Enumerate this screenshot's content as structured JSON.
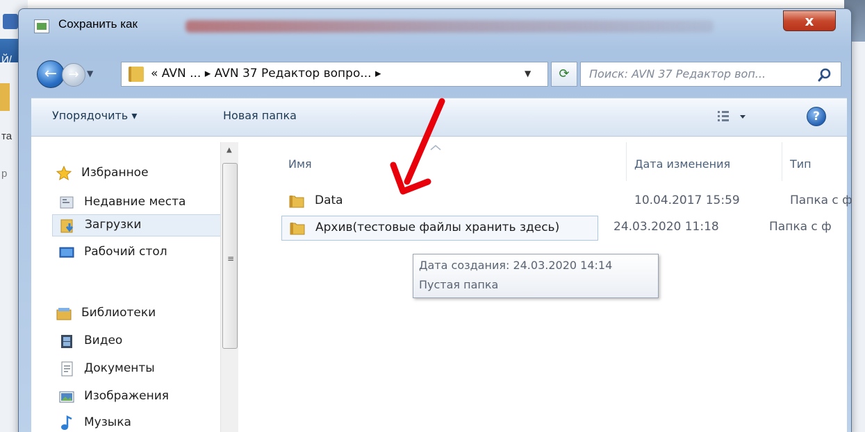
{
  "background_app": {
    "fragment_letters": [
      "Й/",
      "та",
      "р"
    ]
  },
  "window": {
    "title": "Сохранить как",
    "close_glyph": "x"
  },
  "address": {
    "path": "« AVN ... ▸ AVN 37 Редактор вопро... ▸",
    "search_placeholder": "Поиск: AVN 37 Редактор воп..."
  },
  "toolbar": {
    "organize_label": "Упорядочить ▾",
    "new_folder_label": "Новая папка",
    "help_glyph": "?"
  },
  "nav": {
    "favorites": {
      "label": "Избранное",
      "items": [
        {
          "label": "Недавние места",
          "icon": "recent-places-icon"
        },
        {
          "label": "Загрузки",
          "icon": "downloads-icon",
          "selected": true
        },
        {
          "label": "Рабочий стол",
          "icon": "desktop-icon"
        }
      ]
    },
    "libraries": {
      "label": "Библиотеки",
      "items": [
        {
          "label": "Видео",
          "icon": "video-icon"
        },
        {
          "label": "Документы",
          "icon": "documents-icon"
        },
        {
          "label": "Изображения",
          "icon": "pictures-icon"
        },
        {
          "label": "Музыка",
          "icon": "music-icon"
        }
      ]
    }
  },
  "file_list": {
    "columns": [
      "Имя",
      "Дата изменения",
      "Тип"
    ],
    "rows": [
      {
        "name": "Data",
        "date": "10.04.2017 15:59",
        "type": "Папка с ф"
      },
      {
        "name": "Архив(тестовые файлы хранить здесь)",
        "date": "24.03.2020 11:18",
        "type": "Папка с ф"
      }
    ]
  },
  "tooltip": {
    "line1": "Дата создания: 24.03.2020 14:14",
    "line2": "Пустая папка"
  },
  "colors": {
    "annotation_arrow": "#e8000b",
    "selection": "#cce0f7",
    "title_bar": "#b7cce6"
  }
}
